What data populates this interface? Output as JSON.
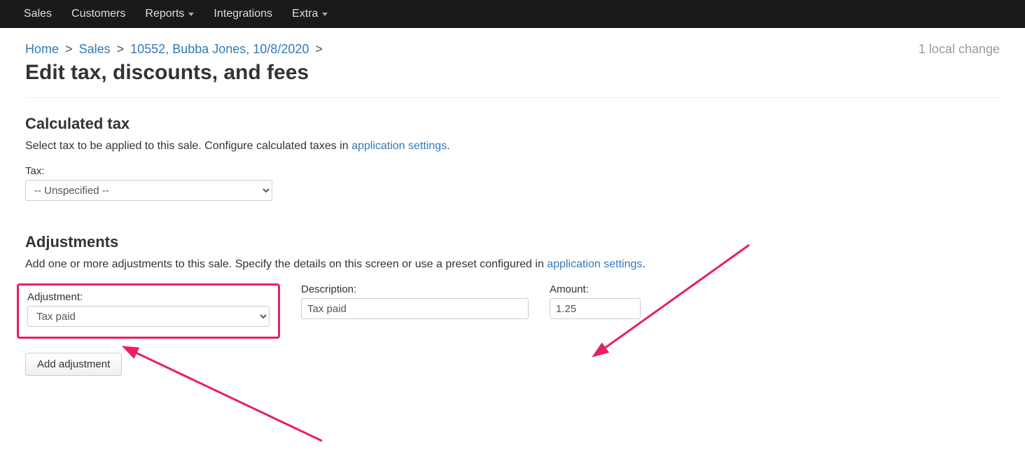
{
  "nav": {
    "sales": "Sales",
    "customers": "Customers",
    "reports": "Reports",
    "integrations": "Integrations",
    "extra": "Extra"
  },
  "breadcrumb": {
    "home": "Home",
    "sales": "Sales",
    "record": "10552, Bubba Jones, 10/8/2020",
    "sep": ">"
  },
  "local_changes": "1 local change",
  "page_title": "Edit tax, discounts, and fees",
  "calc_tax": {
    "heading": "Calculated tax",
    "help_pre": "Select tax to be applied to this sale. Configure calculated taxes in ",
    "help_link": "application settings",
    "help_post": ".",
    "tax_label": "Tax:",
    "tax_value": "-- Unspecified --"
  },
  "adjustments": {
    "heading": "Adjustments",
    "help_pre": "Add one or more adjustments to this sale. Specify the details on this screen or use a preset configured in ",
    "help_link": "application settings",
    "help_post": ".",
    "adjustment_label": "Adjustment:",
    "adjustment_value": "Tax paid",
    "description_label": "Description:",
    "description_value": "Tax paid",
    "amount_label": "Amount:",
    "amount_value": "1.25",
    "add_button": "Add adjustment"
  }
}
